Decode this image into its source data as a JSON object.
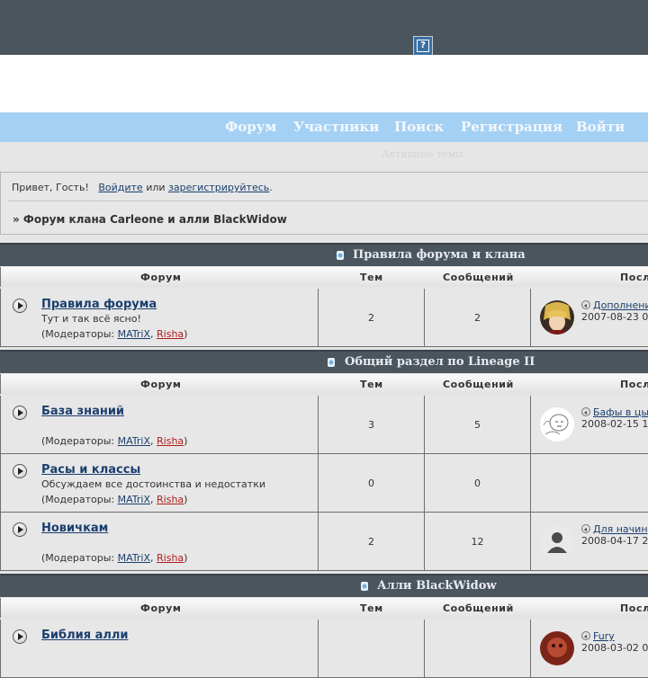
{
  "nav": {
    "items": [
      "Форум",
      "Участники",
      "Поиск",
      "Регистрация",
      "Войти"
    ],
    "active_topics": "Активные темы"
  },
  "greeting": {
    "prefix": "Привет, Гость!",
    "login": "Войдите",
    "or": "или",
    "register": "зарегистрируйтесь",
    "suffix": "."
  },
  "breadcrumb": "» Форум клана Carleone и алли BlackWidow",
  "columns": {
    "forum": "Форум",
    "topics": "Тем",
    "posts": "Сообщений",
    "last": "Посл"
  },
  "categories": [
    {
      "title": "Правила форума и клана",
      "forums": [
        {
          "name": "Правила форума",
          "desc": "Тут и так всё ясно!",
          "mods_prefix": "(Модераторы: ",
          "mod1": "MATriX",
          "sep": ", ",
          "mod2": "Risha",
          "mods_suffix": ")",
          "topics": "2",
          "posts": "2",
          "last_title": "Дополнени",
          "last_date": "2007-08-23 0",
          "avatar": "anime-avatar"
        }
      ]
    },
    {
      "title": "Общий раздел по Lineage II",
      "forums": [
        {
          "name": "База знаний",
          "desc": "",
          "mods_prefix": "(Модераторы: ",
          "mod1": "MATriX",
          "sep": ", ",
          "mod2": "Risha",
          "mods_suffix": ")",
          "topics": "3",
          "posts": "5",
          "last_title": "Бафы в цы",
          "last_date": "2008-02-15 1",
          "avatar": "sketch-avatar"
        },
        {
          "name": "Расы и классы",
          "desc": "Обсуждаем все достоинства и недостатки",
          "mods_prefix": "(Модераторы: ",
          "mod1": "MATriX",
          "sep": ", ",
          "mod2": "Risha",
          "mods_suffix": ")",
          "topics": "0",
          "posts": "0",
          "last_title": "",
          "last_date": "",
          "avatar": ""
        },
        {
          "name": "Новичкам",
          "desc": "",
          "mods_prefix": "(Модераторы: ",
          "mod1": "MATriX",
          "sep": ", ",
          "mod2": "Risha",
          "mods_suffix": ")",
          "topics": "2",
          "posts": "12",
          "last_title": "Для начин",
          "last_date": "2008-04-17 2",
          "avatar": "default-avatar"
        }
      ]
    },
    {
      "title": "Алли BlackWidow",
      "forums": [
        {
          "name": "Библия алли",
          "desc": "",
          "mods_prefix": "",
          "mod1": "",
          "sep": "",
          "mod2": "",
          "mods_suffix": "",
          "topics": "",
          "posts": "",
          "last_title": "Fury",
          "last_date": "2008-03-02 0",
          "avatar": "red-avatar"
        }
      ]
    }
  ],
  "colors": {
    "topbar": "#4b555e",
    "navbar": "#a4d0f4",
    "link": "#1b3f6e",
    "moderator_red": "#b01c1c"
  }
}
